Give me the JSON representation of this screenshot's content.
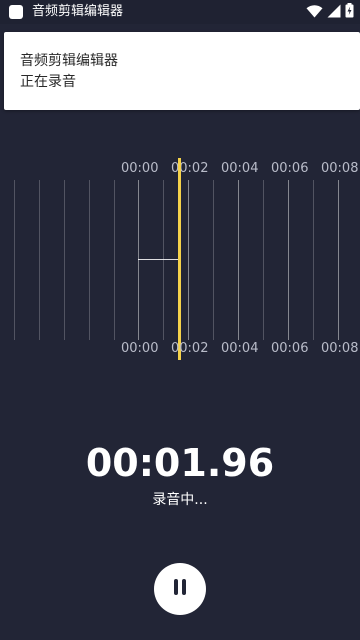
{
  "status_bar": {
    "app_title": "音频剪辑编辑器",
    "icons": [
      "wifi-icon",
      "signal-icon",
      "battery-charging-icon"
    ]
  },
  "notification": {
    "title": "音频剪辑编辑器",
    "text": "正在录音"
  },
  "timeline": {
    "top_ticks": [
      "00:00",
      "00:02",
      "00:04",
      "00:06",
      "00:08"
    ],
    "bottom_ticks": [
      "00:00",
      "00:02",
      "00:04",
      "00:06",
      "00:08"
    ]
  },
  "recorder": {
    "elapsed": "00:01.96",
    "status": "录音中..."
  },
  "controls": {
    "pause_icon": "pause-icon"
  },
  "colors": {
    "background": "#222536",
    "playhead": "#f5d24b",
    "tick_text": "#b9bcc9"
  }
}
